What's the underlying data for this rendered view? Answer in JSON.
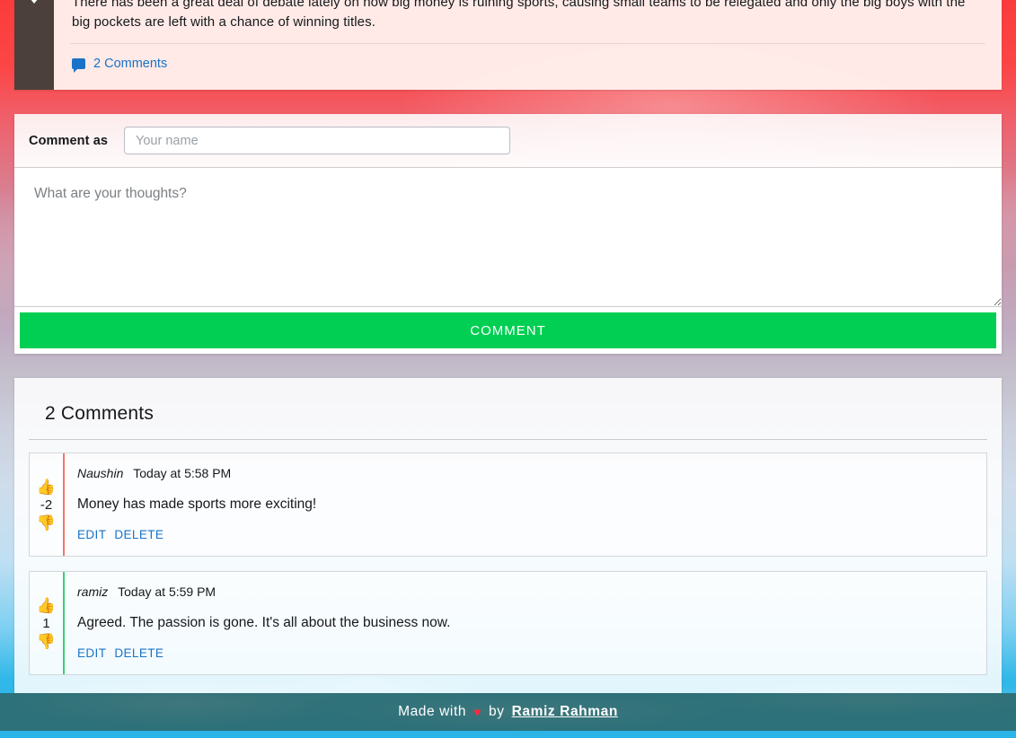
{
  "post": {
    "text": "There has been a great deal of debate lately on how big money is ruining sports, causing small teams to be relegated and only the big boys with the big pockets are left with a chance of winning titles.",
    "comments_link_label": "2 Comments",
    "comment_icon": "comment-bubble-icon",
    "downvote_icon": "downvote-arrow-icon"
  },
  "form": {
    "comment_as_label": "Comment as",
    "name_placeholder": "Your name",
    "name_value": "",
    "thoughts_placeholder": "What are your thoughts?",
    "thoughts_value": "",
    "submit_label": "COMMENT",
    "submit_color": "#00cf53"
  },
  "comments_section": {
    "heading": "2 Comments",
    "items": [
      {
        "author": "Naushin",
        "time": "Today at 5:58 PM",
        "text": "Money has made sports more exciting!",
        "score": "-2",
        "accent_color": "#f4766b",
        "upvote_icon": "thumbs-up-icon",
        "downvote_icon": "thumbs-down-icon",
        "edit_label": "EDIT",
        "delete_label": "DELETE"
      },
      {
        "author": "ramiz",
        "time": "Today at 5:59 PM",
        "text": "Agreed. The passion is gone. It's all about the business now.",
        "score": "1",
        "accent_color": "#3ccf74",
        "upvote_icon": "thumbs-up-icon",
        "downvote_icon": "thumbs-down-icon",
        "edit_label": "EDIT",
        "delete_label": "DELETE"
      }
    ]
  },
  "footer": {
    "made_with": "Made with",
    "heart": "♥",
    "by": "by",
    "author": "Ramiz  Rahman"
  },
  "theme": {
    "link_blue": "#1a73c7",
    "accent_green": "#00cf53",
    "vote_column_dark": "#4b403c",
    "footer_teal": "#2d6162",
    "heart_red": "#ff2b3d"
  }
}
